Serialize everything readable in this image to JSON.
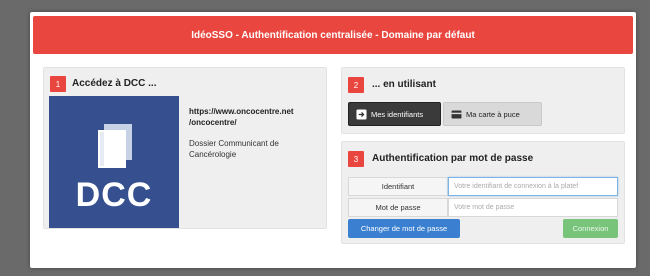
{
  "header": {
    "title": "IdéoSSO - Authentification centralisée - Domaine par défaut"
  },
  "colors": {
    "accent": "#e8463f",
    "logo_bg": "#36508f",
    "primary": "#3b7fd0",
    "success": "#79c47b"
  },
  "step1": {
    "number": "1",
    "title": "Accédez à DCC ...",
    "logo_text": "DCC",
    "url_line1": "https://www.oncocentre.net",
    "url_line2": "/oncocentre/",
    "desc_line1": "Dossier Communicant de",
    "desc_line2": "Cancérologie"
  },
  "step2": {
    "number": "2",
    "title": "... en utilisant",
    "btn_identifiers": "Mes identifiants",
    "btn_identifiers_icon": "sign-in-icon",
    "btn_card": "Ma carte à puce",
    "btn_card_icon": "card-icon"
  },
  "step3": {
    "number": "3",
    "title": "Authentification par mot de passe",
    "id_label": "Identifiant",
    "id_placeholder": "Votre identifiant de connexion à la platef",
    "pw_label": "Mot de passe",
    "pw_placeholder": "Votre mot de passe",
    "change_pw_label": "Changer de mot de passe",
    "connect_label": "Connexion"
  }
}
